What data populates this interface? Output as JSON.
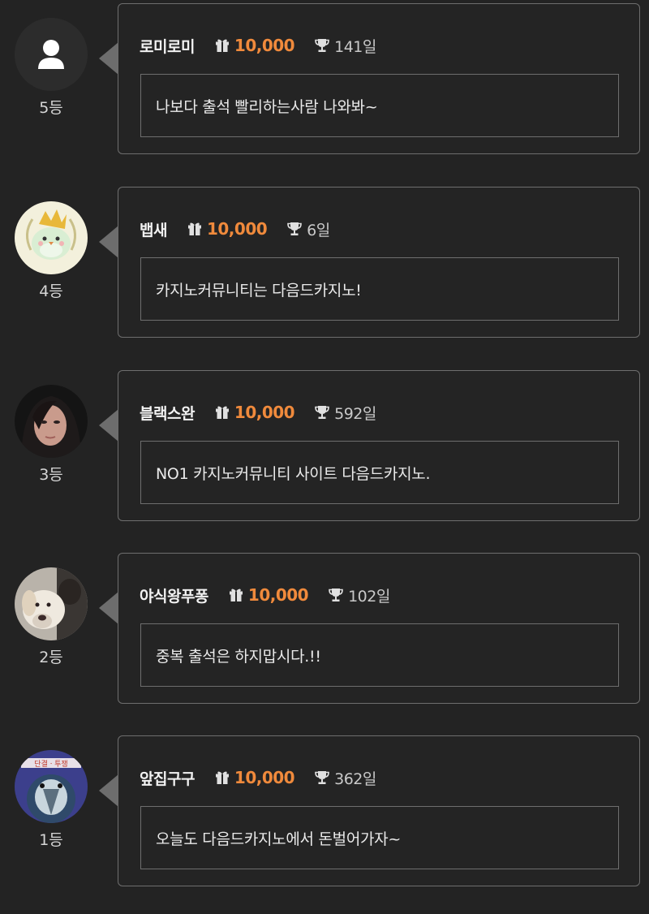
{
  "entries": [
    {
      "rank": "5등",
      "nickname": "로미로미",
      "points": "10,000",
      "days": "141일",
      "message": "나보다 출석 빨리하는사람 나와봐~",
      "avatar_icon": "user-silhouette-icon"
    },
    {
      "rank": "4등",
      "nickname": "뱁새",
      "points": "10,000",
      "days": "6일",
      "message": "카지노커뮤니티는 다음드카지노!",
      "avatar_icon": "bird-avatar"
    },
    {
      "rank": "3등",
      "nickname": "블랙스완",
      "points": "10,000",
      "days": "592일",
      "message": "NO1 카지노커뮤니티 사이트 다음드카지노.",
      "avatar_icon": "portrait-avatar"
    },
    {
      "rank": "2등",
      "nickname": "야식왕푸퐁",
      "points": "10,000",
      "days": "102일",
      "message": "중복 출석은 하지맙시다.!!",
      "avatar_icon": "dog-avatar"
    },
    {
      "rank": "1등",
      "nickname": "앞집구구",
      "points": "10,000",
      "days": "362일",
      "message": "오늘도 다음드카지노에서 돈벌어가자~",
      "avatar_icon": "character-avatar"
    }
  ],
  "icons": {
    "points": "gift-icon",
    "days": "trophy-icon"
  },
  "colors": {
    "background": "#232323",
    "border": "#6e6e6e",
    "points": "#f08a3c"
  }
}
